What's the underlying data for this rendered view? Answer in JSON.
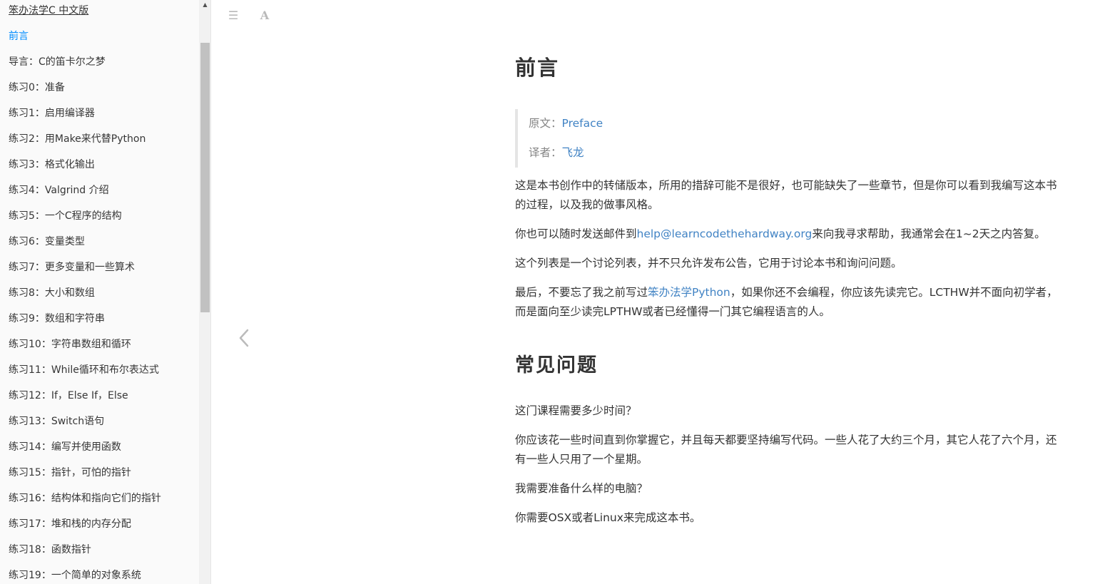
{
  "sidebar": {
    "book_title": "笨办法学C 中文版",
    "items": [
      "前言",
      "导言：C的笛卡尔之梦",
      "练习0：准备",
      "练习1：启用编译器",
      "练习2：用Make来代替Python",
      "练习3：格式化输出",
      "练习4：Valgrind 介绍",
      "练习5：一个C程序的结构",
      "练习6：变量类型",
      "练习7：更多变量和一些算术",
      "练习8：大小和数组",
      "练习9：数组和字符串",
      "练习10：字符串数组和循环",
      "练习11：While循环和布尔表达式",
      "练习12：If，Else If，Else",
      "练习13：Switch语句",
      "练习14：编写并使用函数",
      "练习15：指针，可怕的指针",
      "练习16：结构体和指向它们的指针",
      "练习17：堆和栈的内存分配",
      "练习18：函数指针",
      "练习19：一个简单的对象系统"
    ],
    "active_index": 0
  },
  "toolbar": {
    "menu_icon": "☰",
    "font_icon": "A"
  },
  "content": {
    "title": "前言",
    "quote": {
      "source_label": "原文：",
      "source_link": "Preface",
      "translator_label": "译者：",
      "translator_link": "飞龙"
    },
    "para1": "这是本书创作中的转储版本，所用的措辞可能不是很好，也可能缺失了一些章节，但是你可以看到我编写这本书的过程，以及我的做事风格。",
    "para2_before": "你也可以随时发送邮件到",
    "para2_link": "help@learncodethehardway.org",
    "para2_after": "来向我寻求帮助，我通常会在1~2天之内答复。",
    "para3": "这个列表是一个讨论列表，并不只允许发布公告，它用于讨论本书和询问问题。",
    "para4_before": "最后，不要忘了我之前写过",
    "para4_link": "笨办法学Python",
    "para4_after": "，如果你还不会编程，你应该先读完它。LCTHW并不面向初学者，而是面向至少读完LPTHW或者已经懂得一门其它编程语言的人。",
    "faq_title": "常见问题",
    "faq": [
      "这门课程需要多少时间？",
      "你应该花一些时间直到你掌握它，并且每天都要坚持编写代码。一些人花了大约三个月，其它人花了六个月，还有一些人只用了一个星期。",
      "我需要准备什么样的电脑？",
      "你需要OSX或者Linux来完成这本书。"
    ]
  }
}
